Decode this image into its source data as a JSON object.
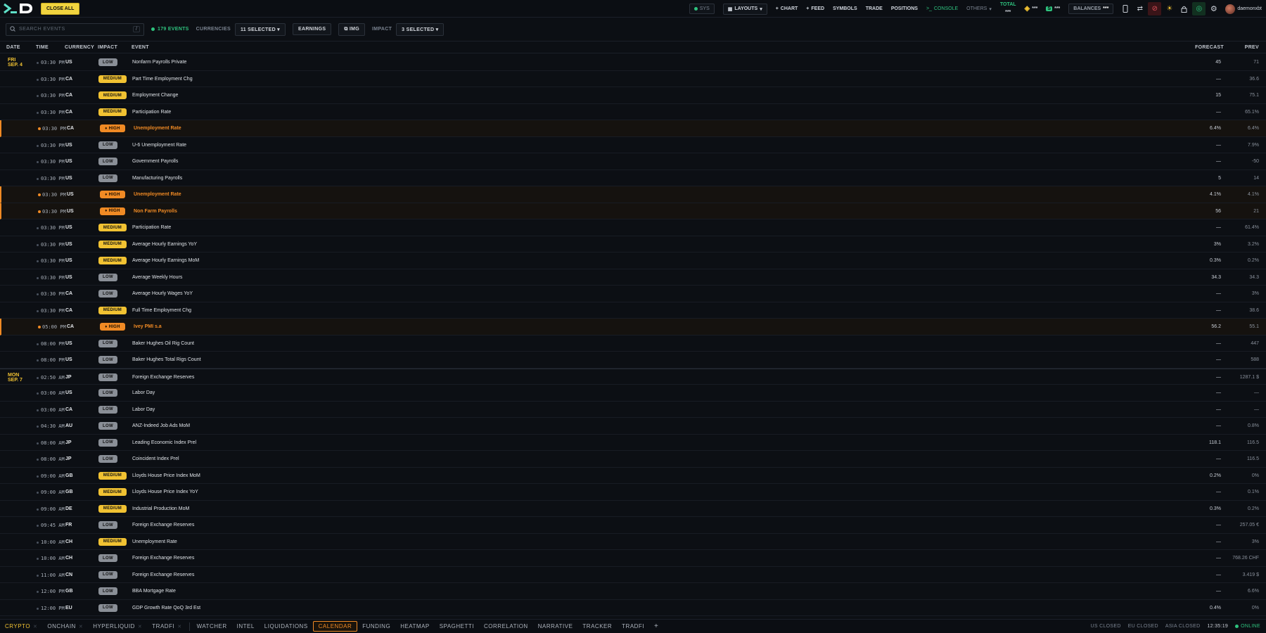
{
  "topbar": {
    "close_all": "CLOSE ALL",
    "sys": "SYS",
    "layouts": "LAYOUTS",
    "chart": "CHART",
    "feed": "FEED",
    "symbols": "SYMBOLS",
    "trade": "TRADE",
    "positions": "POSITIONS",
    "console": "CONSOLE",
    "others": "OTHERS",
    "total_label": "TOTAL",
    "total_value": "***",
    "binance_value": "***",
    "exchange2_value": "***",
    "balances_label": "BALANCES",
    "balances_value": "***",
    "username": "daemonxbt"
  },
  "filters": {
    "search_placeholder": "SEARCH EVENTS",
    "search_shortcut": "/",
    "events_count": "179 EVENTS",
    "currencies_label": "CURRENCIES",
    "currencies_value": "11 SELECTED",
    "earnings": "EARNINGS",
    "img": "IMG",
    "impact_label": "IMPACT",
    "impact_value": "3 SELECTED"
  },
  "columns": {
    "date": "DATE",
    "time": "TIME",
    "currency": "CURRENCY",
    "impact": "IMPACT",
    "event": "EVENT",
    "forecast": "FORECAST",
    "prev": "PREV"
  },
  "rows": [
    {
      "day": "FRI",
      "date": "SEP. 4",
      "time": "03:30 PM",
      "cur": "US",
      "impact": "LOW",
      "event": "Nonfarm Payrolls Private",
      "forecast": "45",
      "prev": "71"
    },
    {
      "time": "03:30 PM",
      "cur": "CA",
      "impact": "MEDIUM",
      "event": "Part Time Employment Chg",
      "forecast": "—",
      "prev": "36.6"
    },
    {
      "time": "03:30 PM",
      "cur": "CA",
      "impact": "MEDIUM",
      "event": "Employment Change",
      "forecast": "15",
      "prev": "75.1"
    },
    {
      "time": "03:30 PM",
      "cur": "CA",
      "impact": "MEDIUM",
      "event": "Participation Rate",
      "forecast": "—",
      "prev": "65.1%"
    },
    {
      "time": "03:30 PM",
      "cur": "CA",
      "impact": "HIGH",
      "event": "Unemployment Rate",
      "forecast": "6.4%",
      "prev": "6.4%"
    },
    {
      "time": "03:30 PM",
      "cur": "US",
      "impact": "LOW",
      "event": "U-6 Unemployment Rate",
      "forecast": "—",
      "prev": "7.9%"
    },
    {
      "time": "03:30 PM",
      "cur": "US",
      "impact": "LOW",
      "event": "Government Payrolls",
      "forecast": "—",
      "prev": "-50"
    },
    {
      "time": "03:30 PM",
      "cur": "US",
      "impact": "LOW",
      "event": "Manufacturing Payrolls",
      "forecast": "5",
      "prev": "14"
    },
    {
      "time": "03:30 PM",
      "cur": "US",
      "impact": "HIGH",
      "event": "Unemployment Rate",
      "forecast": "4.1%",
      "prev": "4.1%"
    },
    {
      "time": "03:30 PM",
      "cur": "US",
      "impact": "HIGH",
      "event": "Non Farm Payrolls",
      "forecast": "56",
      "prev": "21"
    },
    {
      "time": "03:30 PM",
      "cur": "US",
      "impact": "MEDIUM",
      "event": "Participation Rate",
      "forecast": "—",
      "prev": "61.4%"
    },
    {
      "time": "03:30 PM",
      "cur": "US",
      "impact": "MEDIUM",
      "event": "Average Hourly Earnings YoY",
      "forecast": "3%",
      "prev": "3.2%"
    },
    {
      "time": "03:30 PM",
      "cur": "US",
      "impact": "MEDIUM",
      "event": "Average Hourly Earnings MoM",
      "forecast": "0.3%",
      "prev": "0.2%"
    },
    {
      "time": "03:30 PM",
      "cur": "US",
      "impact": "LOW",
      "event": "Average Weekly Hours",
      "forecast": "34.3",
      "prev": "34.3"
    },
    {
      "time": "03:30 PM",
      "cur": "CA",
      "impact": "LOW",
      "event": "Average Hourly Wages YoY",
      "forecast": "—",
      "prev": "3%"
    },
    {
      "time": "03:30 PM",
      "cur": "CA",
      "impact": "MEDIUM",
      "event": "Full Time Employment Chg",
      "forecast": "—",
      "prev": "38.6"
    },
    {
      "time": "05:00 PM",
      "cur": "CA",
      "impact": "HIGH",
      "event": "Ivey PMI s.a",
      "forecast": "56.2",
      "prev": "55.1"
    },
    {
      "time": "08:00 PM",
      "cur": "US",
      "impact": "LOW",
      "event": "Baker Hughes Oil Rig Count",
      "forecast": "—",
      "prev": "447"
    },
    {
      "time": "08:00 PM",
      "cur": "US",
      "impact": "LOW",
      "event": "Baker Hughes Total Rigs Count",
      "forecast": "—",
      "prev": "588"
    },
    {
      "day": "MON",
      "date": "SEP. 7",
      "time": "02:50 AM",
      "cur": "JP",
      "impact": "LOW",
      "event": "Foreign Exchange Reserves",
      "forecast": "—",
      "prev": "1287.1 $"
    },
    {
      "time": "03:00 AM",
      "cur": "US",
      "impact": "LOW",
      "event": "Labor Day",
      "forecast": "—",
      "prev": "—"
    },
    {
      "time": "03:00 AM",
      "cur": "CA",
      "impact": "LOW",
      "event": "Labor Day",
      "forecast": "—",
      "prev": "—"
    },
    {
      "time": "04:30 AM",
      "cur": "AU",
      "impact": "LOW",
      "event": "ANZ-Indeed Job Ads MoM",
      "forecast": "—",
      "prev": "0.8%"
    },
    {
      "time": "08:00 AM",
      "cur": "JP",
      "impact": "LOW",
      "event": "Leading Economic Index Prel",
      "forecast": "118.1",
      "prev": "116.5"
    },
    {
      "time": "08:00 AM",
      "cur": "JP",
      "impact": "LOW",
      "event": "Coincident Index Prel",
      "forecast": "—",
      "prev": "116.5"
    },
    {
      "time": "09:00 AM",
      "cur": "GB",
      "impact": "MEDIUM",
      "event": "Lloyds House Price Index MoM",
      "forecast": "0.2%",
      "prev": "0%"
    },
    {
      "time": "09:00 AM",
      "cur": "GB",
      "impact": "MEDIUM",
      "event": "Lloyds House Price Index YoY",
      "forecast": "—",
      "prev": "0.1%"
    },
    {
      "time": "09:00 AM",
      "cur": "DE",
      "impact": "MEDIUM",
      "event": "Industrial Production MoM",
      "forecast": "0.3%",
      "prev": "0.2%"
    },
    {
      "time": "09:45 AM",
      "cur": "FR",
      "impact": "LOW",
      "event": "Foreign Exchange Reserves",
      "forecast": "—",
      "prev": "257.05 €"
    },
    {
      "time": "10:00 AM",
      "cur": "CH",
      "impact": "MEDIUM",
      "event": "Unemployment Rate",
      "forecast": "—",
      "prev": "3%"
    },
    {
      "time": "10:00 AM",
      "cur": "CH",
      "impact": "LOW",
      "event": "Foreign Exchange Reserves",
      "forecast": "—",
      "prev": "768.26 CHF"
    },
    {
      "time": "11:00 AM",
      "cur": "CN",
      "impact": "LOW",
      "event": "Foreign Exchange Reserves",
      "forecast": "—",
      "prev": "3.419 $"
    },
    {
      "time": "12:00 PM",
      "cur": "GB",
      "impact": "LOW",
      "event": "BBA Mortgage Rate",
      "forecast": "—",
      "prev": "6.6%"
    },
    {
      "time": "12:00 PM",
      "cur": "EU",
      "impact": "LOW",
      "event": "GDP Growth Rate QoQ 3rd Est",
      "forecast": "0.4%",
      "prev": "0%"
    }
  ],
  "bottom_tabs": {
    "group1": [
      "CRYPTO",
      "ONCHAIN",
      "HYPERLIQUID",
      "TRADFI"
    ],
    "group2": [
      "WATCHER",
      "INTEL",
      "LIQUIDATIONS",
      "CALENDAR",
      "FUNDING",
      "HEATMAP",
      "SPAGHETTI",
      "CORRELATION",
      "NARRATIVE",
      "TRACKER",
      "TRADFI"
    ],
    "active": "CALENDAR",
    "add": "+"
  },
  "status": {
    "us": "US CLOSED",
    "eu": "EU CLOSED",
    "asia": "ASIA CLOSED",
    "clock": "12:35:19",
    "online": "ONLINE"
  },
  "colors": {
    "accent_yellow": "#f1c232",
    "accent_orange": "#f08a24",
    "green": "#2ec27e"
  }
}
